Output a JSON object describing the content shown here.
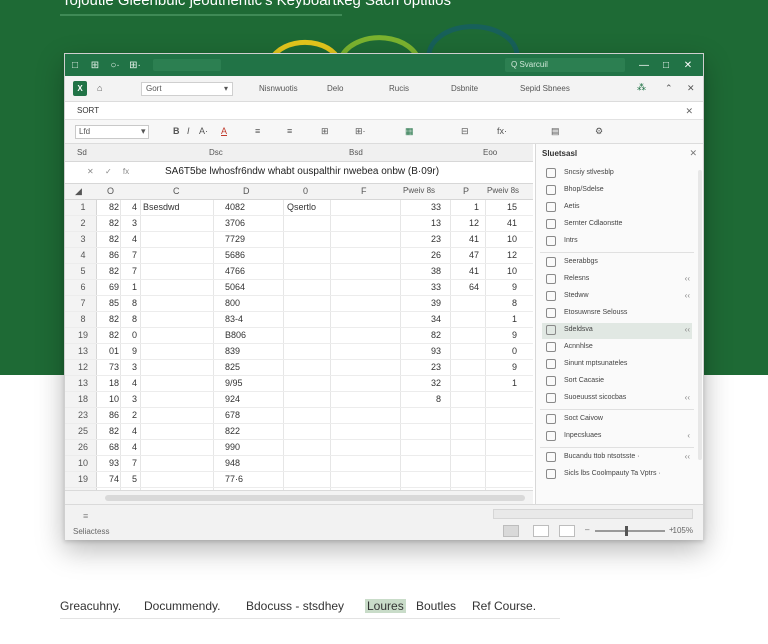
{
  "page": {
    "headline": "Tojoutie Gleenbulc jeoutnentic's Keyboartkeg Sach optitios"
  },
  "titlebar": {
    "icons": [
      "□",
      "⊞",
      "○·",
      "⊞·"
    ],
    "search_text": "Q Svarcuil",
    "controls": [
      "—",
      "□",
      "✕"
    ]
  },
  "menubar": {
    "xl_label": "X",
    "dropdown_value": "Gort",
    "items": [
      "Nisnwuotis",
      "Delo",
      "Rucis",
      "Dsbnite",
      "Sepid Sbnees"
    ]
  },
  "sortbar": {
    "label": "SORT",
    "close": "✕"
  },
  "ribbon": {
    "font_value": "Lfd",
    "icons": [
      "B",
      "I",
      "A·",
      "A",
      "≡",
      "≡",
      "⊞",
      "⊞·",
      "fx·"
    ]
  },
  "column_strip": {
    "labels": [
      "Sd",
      "Dsc",
      "Bsd",
      "Eoo"
    ]
  },
  "formula_bar": {
    "buttons": [
      "✕",
      "✓",
      "fx"
    ],
    "text": "SA6T5be lwhosfr6ndw whabt ouspalthir nwebea onbw (B·09r)"
  },
  "grid": {
    "headers": [
      "O",
      "C",
      "D",
      "0",
      "F",
      "Pweiv 8s",
      "P",
      "Pweiv 8s"
    ],
    "rows": [
      {
        "n": "1",
        "a": "82",
        "b": "4",
        "c": "Bsesdwd",
        "d": "4082",
        "e": "Qsertlo",
        "f": "33",
        "g": "1",
        "h": "15"
      },
      {
        "n": "2",
        "a": "82",
        "b": "3",
        "c": "",
        "d": "3706",
        "e": "",
        "f": "13",
        "g": "12",
        "h": "41"
      },
      {
        "n": "3",
        "a": "82",
        "b": "4",
        "c": "",
        "d": "7729",
        "e": "",
        "f": "23",
        "g": "41",
        "h": "10"
      },
      {
        "n": "4",
        "a": "86",
        "b": "7",
        "c": "",
        "d": "5686",
        "e": "",
        "f": "26",
        "g": "47",
        "h": "12"
      },
      {
        "n": "5",
        "a": "82",
        "b": "7",
        "c": "",
        "d": "4766",
        "e": "",
        "f": "38",
        "g": "41",
        "h": "10"
      },
      {
        "n": "6",
        "a": "69",
        "b": "1",
        "c": "",
        "d": "5064",
        "e": "",
        "f": "33",
        "g": "64",
        "h": "9"
      },
      {
        "n": "7",
        "a": "85",
        "b": "8",
        "c": "",
        "d": "800",
        "e": "",
        "f": "39",
        "g": "",
        "h": "8"
      },
      {
        "n": "8",
        "a": "82",
        "b": "8",
        "c": "",
        "d": "83-4",
        "e": "",
        "f": "34",
        "g": "",
        "h": "1"
      },
      {
        "n": "19",
        "a": "82",
        "b": "0",
        "c": "",
        "d": "B806",
        "e": "",
        "f": "82",
        "g": "",
        "h": "9"
      },
      {
        "n": "13",
        "a": "01",
        "b": "9",
        "c": "",
        "d": "839",
        "e": "",
        "f": "93",
        "g": "",
        "h": "0"
      },
      {
        "n": "12",
        "a": "73",
        "b": "3",
        "c": "",
        "d": "825",
        "e": "",
        "f": "23",
        "g": "",
        "h": "9"
      },
      {
        "n": "13",
        "a": "18",
        "b": "4",
        "c": "",
        "d": "9/95",
        "e": "",
        "f": "32",
        "g": "",
        "h": "1"
      },
      {
        "n": "18",
        "a": "10",
        "b": "3",
        "c": "",
        "d": "924",
        "e": "",
        "f": "8",
        "g": "",
        "h": ""
      },
      {
        "n": "23",
        "a": "86",
        "b": "2",
        "c": "",
        "d": "678",
        "e": "",
        "f": "",
        "g": "",
        "h": ""
      },
      {
        "n": "25",
        "a": "82",
        "b": "4",
        "c": "",
        "d": "822",
        "e": "",
        "f": "",
        "g": "",
        "h": ""
      },
      {
        "n": "26",
        "a": "68",
        "b": "4",
        "c": "",
        "d": "990",
        "e": "",
        "f": "",
        "g": "",
        "h": ""
      },
      {
        "n": "10",
        "a": "93",
        "b": "7",
        "c": "",
        "d": "948",
        "e": "",
        "f": "",
        "g": "",
        "h": ""
      },
      {
        "n": "19",
        "a": "74",
        "b": "5",
        "c": "",
        "d": "77·6",
        "e": "",
        "f": "",
        "g": "",
        "h": ""
      }
    ]
  },
  "panel": {
    "title": "Sluetsasl",
    "close": "✕",
    "items": [
      {
        "label": "Sncsiy stlvesblp",
        "chev": ""
      },
      {
        "label": "Bhop/Sdelse",
        "chev": ""
      },
      {
        "label": "Aetis",
        "chev": ""
      },
      {
        "label": "Sernter Cdlaonstte",
        "chev": ""
      },
      {
        "label": "Intrs",
        "chev": ""
      },
      {
        "label": "Seerabbgs",
        "chev": ""
      },
      {
        "label": "Relesns",
        "chev": "‹‹"
      },
      {
        "label": "Stedww",
        "chev": "‹‹"
      },
      {
        "label": "Etosuwnsre Selouss",
        "chev": ""
      },
      {
        "label": "Sdeldsva",
        "chev": "‹‹"
      },
      {
        "label": "Acnnhlse",
        "chev": ""
      },
      {
        "label": "Sinunt mptsunateles",
        "chev": ""
      },
      {
        "label": "Sort Cacasie",
        "chev": ""
      },
      {
        "label": "Suoeuusst sicocbas",
        "chev": "‹‹"
      },
      {
        "label": "Soct Caivow",
        "chev": ""
      },
      {
        "label": "Inpecsluaes",
        "chev": "‹"
      },
      {
        "label": "Bucandu ttob ntsotsste ·",
        "chev": "‹‹"
      },
      {
        "label": "Sicls lbs Coolmpauty Ta Vptrs ·",
        "chev": ""
      }
    ]
  },
  "statusbar": {
    "sheet_tab": "≡",
    "label": "Seliactess",
    "zoom": "105%"
  },
  "footer": {
    "items": [
      "Greacuhny.",
      "Docummendy.",
      "Bdocuss - stsdhey",
      "Loures",
      "Boutles",
      "Ref Course."
    ]
  },
  "colors": {
    "brand_green": "#1e6a35",
    "excel_green": "#217346",
    "arc_yellow": "#e4c61c",
    "arc_lime": "#7bb32f",
    "arc_teal": "#17605a"
  }
}
